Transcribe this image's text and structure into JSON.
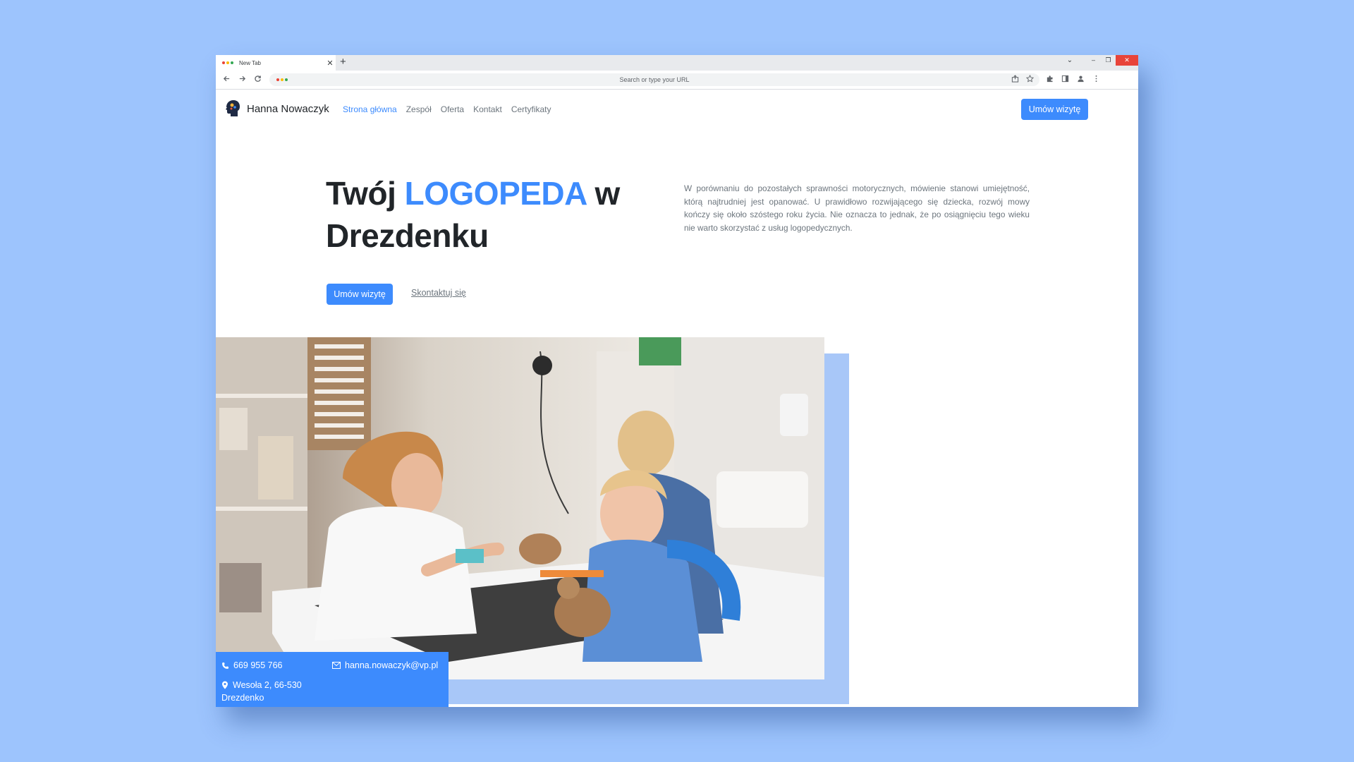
{
  "browser": {
    "tab_title": "New Tab",
    "tab_close": "✕",
    "new_tab": "+",
    "address_placeholder": "Search or type your URL",
    "window_controls": {
      "chevron": "⌄",
      "minimize": "–",
      "restore": "❐",
      "close": "✕"
    },
    "nav_icons": [
      "back-icon",
      "forward-icon",
      "reload-icon"
    ],
    "toolbar_icons": [
      "share-icon",
      "star-icon",
      "extensions-icon",
      "sidepanel-icon",
      "profile-icon",
      "menu-icon"
    ],
    "traffic_dots": [
      "#ea4335",
      "#fbbc05",
      "#34a853"
    ]
  },
  "site": {
    "brand": "Hanna Nowaczyk",
    "nav": [
      {
        "label": "Strona główna",
        "active": true
      },
      {
        "label": "Zespół",
        "active": false
      },
      {
        "label": "Oferta",
        "active": false
      },
      {
        "label": "Kontakt",
        "active": false
      },
      {
        "label": "Certyfikaty",
        "active": false
      }
    ],
    "header_cta": "Umów wizytę",
    "accent_color": "#3d8bfd"
  },
  "hero": {
    "title_pre": "Twój ",
    "title_accent": "LOGOPEDA",
    "title_post": " w Drezdenku",
    "description": "W porównaniu do pozostałych sprawności motorycznych, mówienie stanowi umiejętność, którą najtrudniej jest opanować. U prawidłowo rozwijającego się dziecka, rozwój mowy kończy się około szóstego roku życia. Nie oznacza to jednak, że po osiągnięciu tego wieku nie warto skorzystać z usług logopedycznych.",
    "primary_cta": "Umów wizytę",
    "secondary_cta": "Skontaktuj się"
  },
  "contact": {
    "phone": "669 955 766",
    "email": "hanna.nowaczyk@vp.pl",
    "address_line1": "Wesoła 2, 66-530",
    "address_line2": "Drezdenko"
  }
}
